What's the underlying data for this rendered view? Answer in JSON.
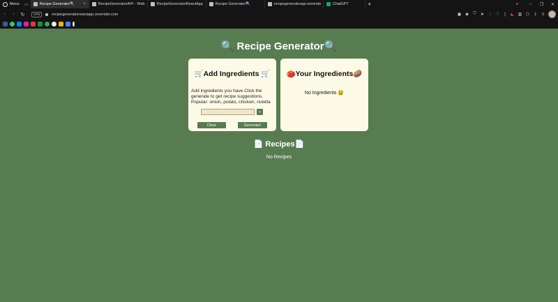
{
  "browser": {
    "menu_label": "Menu",
    "tabs": [
      {
        "title": "Recipe Generator🔍",
        "icon": "cart-icon",
        "active": true
      },
      {
        "title": "RecipeGeneratorAPI - Web",
        "icon": "render-icon",
        "active": false
      },
      {
        "title": "RecipeGeneratorReactApp",
        "icon": "render-icon",
        "active": false
      },
      {
        "title": "Recipe Generator🔍",
        "icon": "cart-icon",
        "active": false
      },
      {
        "title": "recipegeneratorapi.onrende",
        "icon": "globe-icon",
        "active": false
      },
      {
        "title": "ChatGPT",
        "icon": "chatgpt-icon",
        "active": false
      }
    ],
    "new_tab": "+",
    "vpn_label": "VPN",
    "url": "recipegeneratorreactapp.onrender.com"
  },
  "page": {
    "title": "🔍 Recipe Generator🔍",
    "add_card": {
      "title": "🛒Add Ingredients 🛒",
      "description": "Add ingredients you have.Click the generate to get recipe suggestions. Popular: onion, potato, chicken, nutella",
      "input_value": "",
      "input_placeholder": "",
      "add_button": "+",
      "clear_button": "Clear",
      "generate_button": "Generate!"
    },
    "ingredients_card": {
      "title": "🍅Your Ingredients🥔",
      "empty_text": "No Ingredients 🤮"
    },
    "recipes": {
      "title": "📄 Recipes📄",
      "empty_text": "No Recipes"
    }
  },
  "colors": {
    "page_background": "#577c50",
    "card_background": "#fdfbe7",
    "button": "#577c50",
    "chrome": "#141414"
  }
}
